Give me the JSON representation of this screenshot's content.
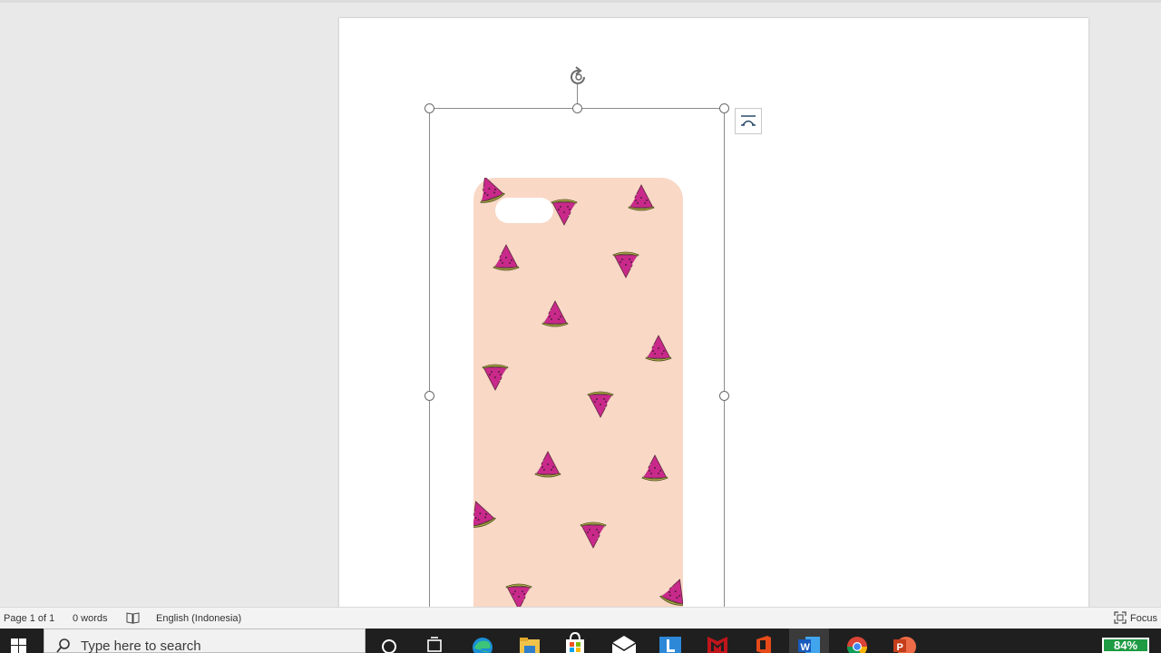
{
  "status_bar": {
    "page_info": "Page 1 of 1",
    "word_count": "0 words",
    "language": "English (Indonesia)",
    "focus_label": "Focus"
  },
  "taskbar": {
    "search_placeholder": "Type here to search",
    "battery": "84%",
    "apps": [
      "cortana-circle-icon",
      "task-view-icon",
      "edge-icon",
      "file-explorer-icon",
      "store-icon",
      "mail-icon",
      "l-app-icon",
      "mcafee-icon",
      "office-icon",
      "word-icon",
      "chrome-icon",
      "powerpoint-icon"
    ]
  },
  "colors": {
    "phone_case": "#f9d8c6",
    "watermelon_flesh": "#c8298a",
    "watermelon_rind": "#b7b84a",
    "selection": "#8a8a8a",
    "battery": "#1e9b43"
  }
}
